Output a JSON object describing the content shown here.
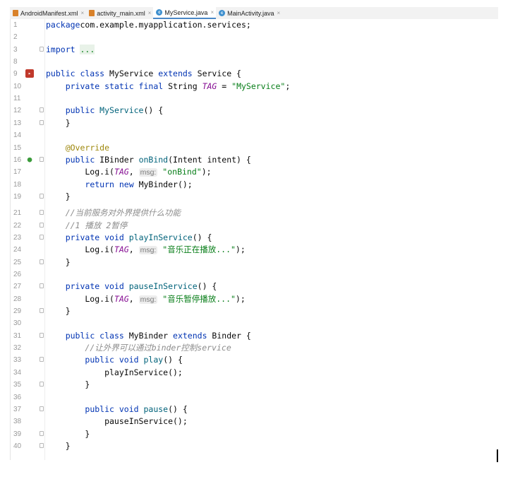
{
  "tabs": [
    {
      "label": "AndroidManifest.xml",
      "icon": "xml-file-icon",
      "active": false
    },
    {
      "label": "activity_main.xml",
      "icon": "xml-file-icon",
      "active": false
    },
    {
      "label": "MyService.java",
      "icon": "java-class-icon",
      "active": true
    },
    {
      "label": "MainActivity.java",
      "icon": "java-class-icon",
      "active": false
    }
  ],
  "close_glyph": "×",
  "lines": [
    {
      "n": "1",
      "parts": [
        [
          "kw",
          "package"
        ],
        [
          "",
          "com.example.myapplication.services;"
        ]
      ]
    },
    {
      "n": "2",
      "parts": []
    },
    {
      "n": "3",
      "parts": [
        [
          "kw",
          "import "
        ],
        [
          "foldtxt",
          "..."
        ]
      ],
      "fold": true
    },
    {
      "n": "8",
      "parts": []
    },
    {
      "n": "9",
      "parts": [
        [
          "kw",
          "public class "
        ],
        [
          "",
          "MyService "
        ],
        [
          "kw",
          "extends "
        ],
        [
          "",
          "Service {"
        ]
      ],
      "icon": "class-run-icon"
    },
    {
      "n": "10",
      "parts": [
        [
          "",
          "    "
        ],
        [
          "kw",
          "private static final "
        ],
        [
          "",
          "String "
        ],
        [
          "fd",
          "TAG"
        ],
        [
          "",
          " = "
        ],
        [
          "st",
          "\"MyService\""
        ],
        [
          "",
          ";"
        ]
      ]
    },
    {
      "n": "11",
      "parts": []
    },
    {
      "n": "12",
      "parts": [
        [
          "",
          "    "
        ],
        [
          "kw",
          "public "
        ],
        [
          "fn",
          "MyService"
        ],
        [
          "",
          "() {"
        ]
      ],
      "fold": true
    },
    {
      "n": "13",
      "parts": [
        [
          "",
          "    }"
        ]
      ],
      "fold": true
    },
    {
      "n": "14",
      "parts": []
    },
    {
      "n": "15",
      "parts": [
        [
          "",
          "    "
        ],
        [
          "an",
          "@Override"
        ]
      ]
    },
    {
      "n": "16",
      "parts": [
        [
          "",
          "    "
        ],
        [
          "kw",
          "public "
        ],
        [
          "",
          "IBinder "
        ],
        [
          "fn",
          "onBind"
        ],
        [
          "",
          "(Intent intent) {"
        ]
      ],
      "fold": true,
      "icon": "override-icon"
    },
    {
      "n": "17",
      "parts": [
        [
          "",
          "        Log."
        ],
        [
          "",
          "i("
        ],
        [
          "fd",
          "TAG"
        ],
        [
          "",
          ", "
        ],
        [
          "hint",
          "msg:"
        ],
        [
          "",
          " "
        ],
        [
          "st",
          "\"onBind\""
        ],
        [
          "",
          ");"
        ]
      ]
    },
    {
      "n": "18",
      "parts": [
        [
          "",
          "        "
        ],
        [
          "kw",
          "return new "
        ],
        [
          "",
          "MyBinder();"
        ]
      ]
    },
    {
      "n": "19",
      "parts": [
        [
          "",
          "    }"
        ]
      ],
      "fold": true
    },
    {
      "n": "21",
      "parts": [
        [
          "",
          "    "
        ],
        [
          "cm",
          "//当前服务对外界提供什么功能"
        ]
      ],
      "fold": true
    },
    {
      "n": "22",
      "parts": [
        [
          "",
          "    "
        ],
        [
          "cm",
          "//1 播放 2暂停"
        ]
      ],
      "fold": true
    },
    {
      "n": "23",
      "parts": [
        [
          "",
          "    "
        ],
        [
          "kw",
          "private void "
        ],
        [
          "fn",
          "playInService"
        ],
        [
          "",
          "() {"
        ]
      ],
      "fold": true
    },
    {
      "n": "24",
      "parts": [
        [
          "",
          "        Log."
        ],
        [
          "",
          "i("
        ],
        [
          "fd",
          "TAG"
        ],
        [
          "",
          ", "
        ],
        [
          "hint",
          "msg:"
        ],
        [
          "",
          " "
        ],
        [
          "st",
          "\"音乐正在播放...\""
        ],
        [
          "",
          ");"
        ]
      ]
    },
    {
      "n": "25",
      "parts": [
        [
          "",
          "    }"
        ]
      ],
      "fold": true
    },
    {
      "n": "26",
      "parts": []
    },
    {
      "n": "27",
      "parts": [
        [
          "",
          "    "
        ],
        [
          "kw",
          "private void "
        ],
        [
          "fn",
          "pauseInService"
        ],
        [
          "",
          "() {"
        ]
      ],
      "fold": true
    },
    {
      "n": "28",
      "parts": [
        [
          "",
          "        Log."
        ],
        [
          "",
          "i("
        ],
        [
          "fd",
          "TAG"
        ],
        [
          "",
          ", "
        ],
        [
          "hint",
          "msg:"
        ],
        [
          "",
          " "
        ],
        [
          "st",
          "\"音乐暂停播放...\""
        ],
        [
          "",
          ");"
        ]
      ]
    },
    {
      "n": "29",
      "parts": [
        [
          "",
          "    }"
        ]
      ],
      "fold": true
    },
    {
      "n": "30",
      "parts": []
    },
    {
      "n": "31",
      "parts": [
        [
          "",
          "    "
        ],
        [
          "kw",
          "public class "
        ],
        [
          "",
          "MyBinder "
        ],
        [
          "kw",
          "extends "
        ],
        [
          "",
          "Binder {"
        ]
      ],
      "fold": true
    },
    {
      "n": "32",
      "parts": [
        [
          "",
          "        "
        ],
        [
          "cm",
          "//让外界可以通过binder控制service"
        ]
      ]
    },
    {
      "n": "33",
      "parts": [
        [
          "",
          "        "
        ],
        [
          "kw",
          "public void "
        ],
        [
          "fn",
          "play"
        ],
        [
          "",
          "() {"
        ]
      ],
      "fold": true
    },
    {
      "n": "34",
      "parts": [
        [
          "",
          "            playInService();"
        ]
      ]
    },
    {
      "n": "35",
      "parts": [
        [
          "",
          "        }"
        ]
      ],
      "fold": true
    },
    {
      "n": "36",
      "parts": []
    },
    {
      "n": "37",
      "parts": [
        [
          "",
          "        "
        ],
        [
          "kw",
          "public void "
        ],
        [
          "fn",
          "pause"
        ],
        [
          "",
          "() {"
        ]
      ],
      "fold": true
    },
    {
      "n": "38",
      "parts": [
        [
          "",
          "            pauseInService();"
        ]
      ]
    },
    {
      "n": "39",
      "parts": [
        [
          "",
          "        }"
        ]
      ],
      "fold": true
    },
    {
      "n": "40",
      "parts": [
        [
          "",
          "    }"
        ]
      ],
      "fold": true
    }
  ]
}
